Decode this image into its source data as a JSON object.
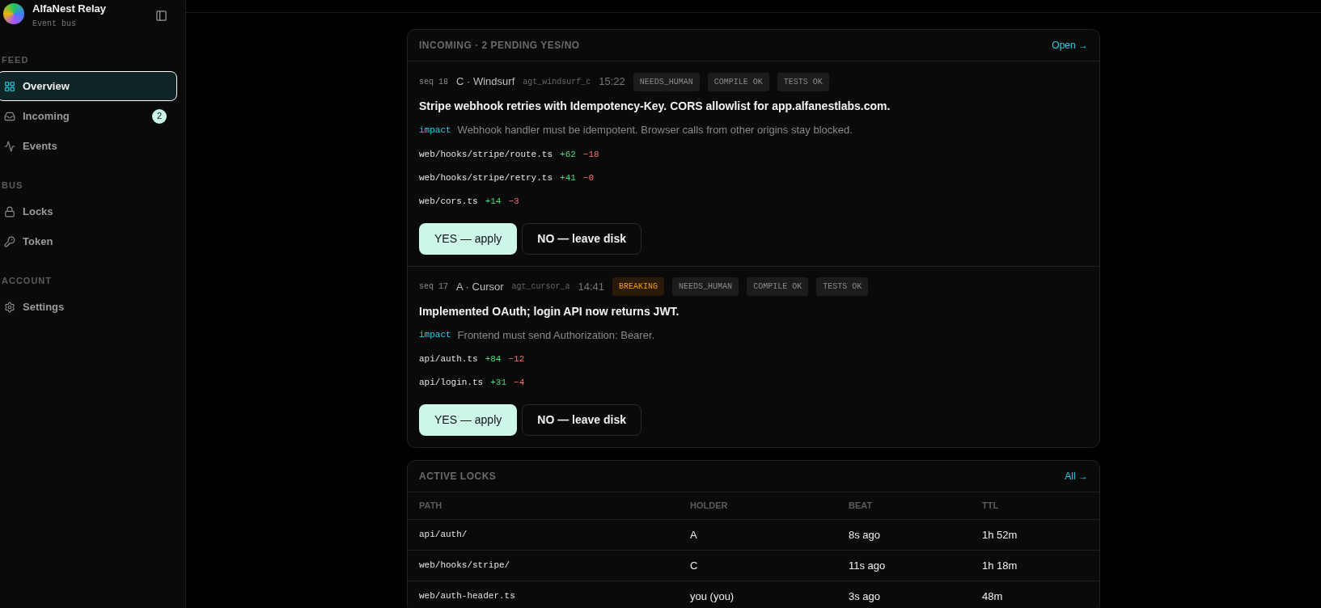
{
  "brand": {
    "name": "AlfaNest Relay",
    "subtitle": "Event bus"
  },
  "sidebar": {
    "sections": [
      {
        "title": "FEED",
        "items": [
          {
            "label": "Overview",
            "kind": "grid",
            "selected": true
          },
          {
            "label": "Incoming",
            "kind": "inbox",
            "selected": false,
            "badge": "2"
          },
          {
            "label": "Events",
            "kind": "activity",
            "selected": false
          }
        ]
      },
      {
        "title": "BUS",
        "items": [
          {
            "label": "Locks",
            "kind": "lock",
            "selected": false
          },
          {
            "label": "Token",
            "kind": "key",
            "selected": false
          }
        ]
      },
      {
        "title": "ACCOUNT",
        "items": [
          {
            "label": "Settings",
            "kind": "settings",
            "selected": false
          }
        ]
      }
    ]
  },
  "incoming": {
    "title": "INCOMING · 2 PENDING YES/NO",
    "link": "Open →",
    "entries": [
      {
        "seq": "seq 18",
        "agent": "C · Windsurf",
        "agent_id": "agt_windsurf_c",
        "time": "15:22",
        "tags": [
          {
            "label": "NEEDS_HUMAN",
            "kind": "neutral"
          },
          {
            "label": "COMPILE OK",
            "kind": "neutral"
          },
          {
            "label": "TESTS OK",
            "kind": "neutral"
          }
        ],
        "summary": "Stripe webhook retries with Idempotency-Key. CORS allowlist for app.alfanestlabs.com.",
        "impact_label": "impact",
        "impact": "Webhook handler must be idempotent. Browser calls from other origins stay blocked.",
        "files": [
          {
            "path": "web/hooks/stripe/route.ts",
            "added": "+62",
            "removed": "−18"
          },
          {
            "path": "web/hooks/stripe/retry.ts",
            "added": "+41",
            "removed": "−0"
          },
          {
            "path": "web/cors.ts",
            "added": "+14",
            "removed": "−3"
          }
        ],
        "yes": "YES — apply",
        "no": "NO — leave disk"
      },
      {
        "seq": "seq 17",
        "agent": "A · Cursor",
        "agent_id": "agt_cursor_a",
        "time": "14:41",
        "tags": [
          {
            "label": "BREAKING",
            "kind": "warning"
          },
          {
            "label": "NEEDS_HUMAN",
            "kind": "neutral"
          },
          {
            "label": "COMPILE OK",
            "kind": "neutral"
          },
          {
            "label": "TESTS OK",
            "kind": "neutral"
          }
        ],
        "summary": "Implemented OAuth; login API now returns JWT.",
        "impact_label": "impact",
        "impact": "Frontend must send Authorization: Bearer.",
        "files": [
          {
            "path": "api/auth.ts",
            "added": "+84",
            "removed": "−12"
          },
          {
            "path": "api/login.ts",
            "added": "+31",
            "removed": "−4"
          }
        ],
        "yes": "YES — apply",
        "no": "NO — leave disk"
      }
    ]
  },
  "locks": {
    "title": "ACTIVE LOCKS",
    "link": "All →",
    "columns": [
      "PATH",
      "HOLDER",
      "BEAT",
      "TTL"
    ],
    "rows": [
      [
        "api/auth/",
        "A",
        "8s ago",
        "1h 52m"
      ],
      [
        "web/hooks/stripe/",
        "C",
        "11s ago",
        "1h 18m"
      ],
      [
        "web/auth-header.ts",
        "you (you)",
        "3s ago",
        "48m"
      ]
    ]
  }
}
